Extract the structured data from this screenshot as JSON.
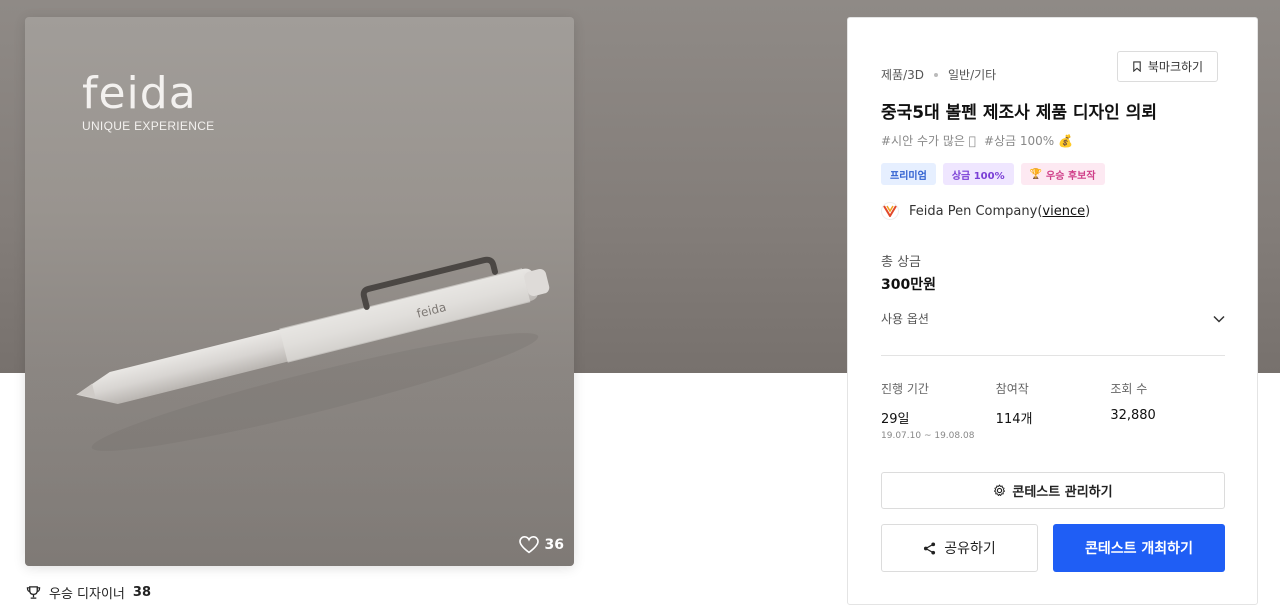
{
  "image": {
    "brand_word": "feida",
    "brand_tagline": "UNIQUE EXPERIENCE",
    "pen_imprint": "feida",
    "like_count": "36"
  },
  "designer": {
    "label": "우승 디자이너",
    "count": "38"
  },
  "panel": {
    "category": "제품/3D",
    "subcategory": "일반/기타",
    "bookmark_label": "북마크하기",
    "title": "중국5대 볼펜 제조사 제품 디자인 의뢰",
    "hashtags": [
      "#시안 수가 많은 🏽",
      "#상금 100% 💰"
    ],
    "badges": {
      "premium": "프리미엄",
      "prize": "상금 100%",
      "award": "우승 후보작"
    },
    "company": {
      "name": "Feida Pen Company",
      "open_paren": "(",
      "id": "vience",
      "close_paren": ")"
    },
    "total_prize_label": "총 상금",
    "total_prize_value": "300만원",
    "options_label": "사용 옵션",
    "stats": {
      "duration_label": "진행 기간",
      "duration_value": "29일",
      "duration_range": "19.07.10 ~ 19.08.08",
      "entries_label": "참여작",
      "entries_value": "114개",
      "views_label": "조회 수",
      "views_value": "32,880"
    },
    "manage_button": "콘테스트 관리하기",
    "share_button": "공유하기",
    "host_button": "콘테스트 개최하기"
  },
  "colors": {
    "primary": "#1f5ef5",
    "hero_bg": "#837d79"
  }
}
